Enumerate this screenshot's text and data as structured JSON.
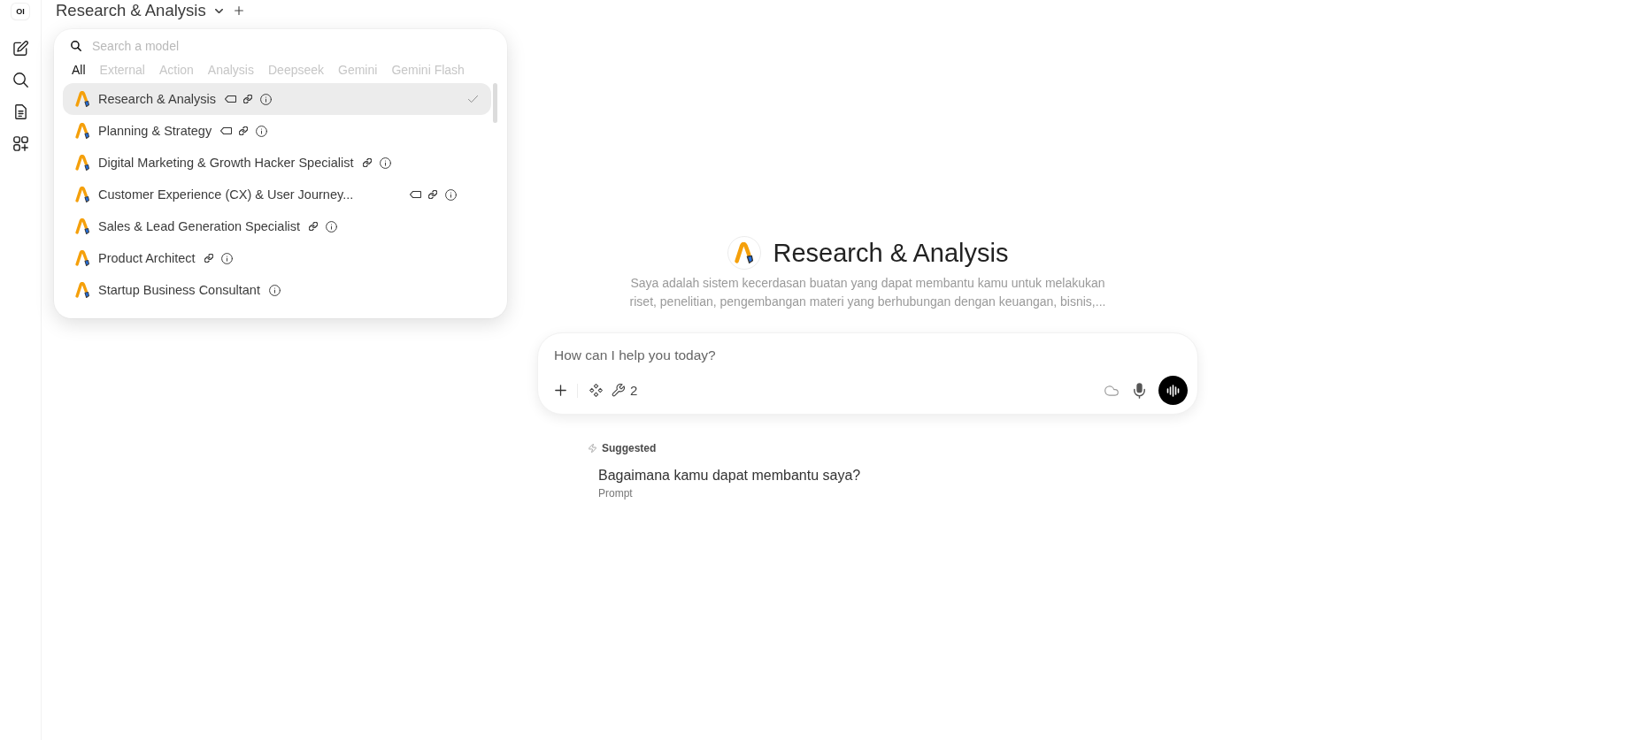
{
  "sidebar": {
    "logo": "OI"
  },
  "header": {
    "model": "Research & Analysis"
  },
  "model_menu": {
    "search": {
      "placeholder": "Search a model"
    },
    "tabs": [
      {
        "label": "All",
        "selected": true
      },
      {
        "label": "External",
        "selected": false
      },
      {
        "label": "Action",
        "selected": false
      },
      {
        "label": "Analysis",
        "selected": false
      },
      {
        "label": "Deepseek",
        "selected": false
      },
      {
        "label": "Gemini",
        "selected": false
      },
      {
        "label": "Gemini Flash",
        "selected": false
      }
    ],
    "models": [
      {
        "name": "Research & Analysis",
        "selected": true,
        "tagged": true,
        "linked": true,
        "truncated": false
      },
      {
        "name": "Planning & Strategy",
        "selected": false,
        "tagged": true,
        "linked": true,
        "truncated": false
      },
      {
        "name": "Digital Marketing & Growth Hacker Specialist",
        "selected": false,
        "tagged": false,
        "linked": true,
        "truncated": false
      },
      {
        "name": "Customer Experience (CX) & User Journey...",
        "selected": false,
        "tagged": true,
        "linked": true,
        "truncated": true
      },
      {
        "name": "Sales & Lead Generation Specialist",
        "selected": false,
        "tagged": false,
        "linked": true,
        "truncated": false
      },
      {
        "name": "Product Architect",
        "selected": false,
        "tagged": false,
        "linked": true,
        "truncated": false
      },
      {
        "name": "Startup Business Consultant",
        "selected": false,
        "tagged": false,
        "linked": false,
        "truncated": false
      }
    ]
  },
  "assistant": {
    "name": "Research & Analysis",
    "description": "Saya adalah sistem kecerdasan buatan yang dapat membantu kamu untuk melakukan riset, penelitian, pengembangan materi yang berhubungan dengan keuangan, bisnis,..."
  },
  "composer": {
    "placeholder": "How can I help you today?",
    "tool_count": "2"
  },
  "suggestions": {
    "heading": "Suggested",
    "items": [
      {
        "title": "Bagaimana kamu dapat membantu saya?",
        "subtitle": "Prompt"
      }
    ]
  }
}
